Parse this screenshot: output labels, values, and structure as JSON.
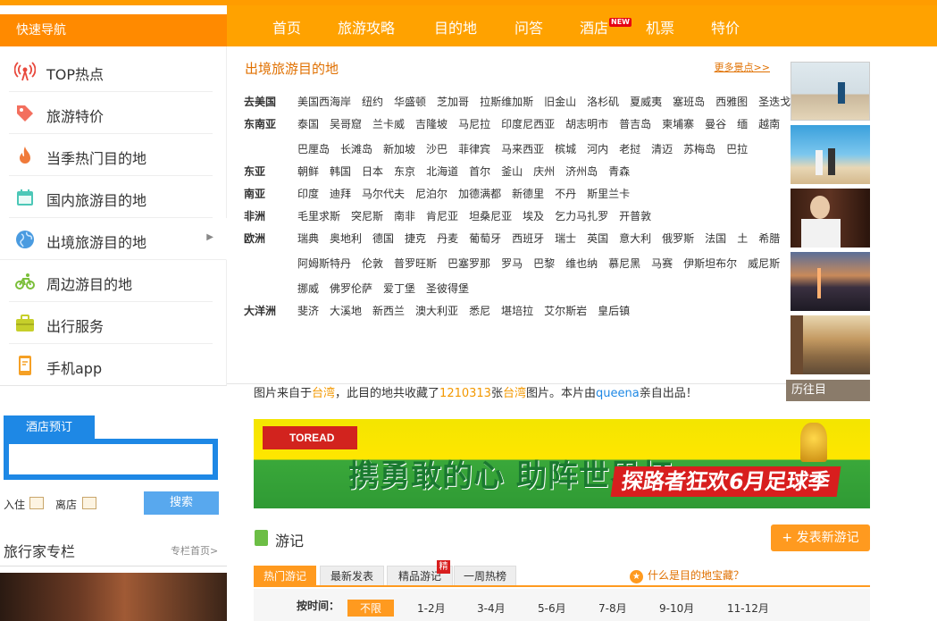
{
  "nav": {
    "quick_nav": "快速导航",
    "items": [
      "首页",
      "旅游攻略",
      "目的地",
      "问答",
      "酒店",
      "机票",
      "特价"
    ],
    "new_badge": "NEW"
  },
  "sidebar": {
    "items": [
      {
        "label": "TOP热点",
        "icon": "signal-icon"
      },
      {
        "label": "旅游特价",
        "icon": "tag-icon"
      },
      {
        "label": "当季热门目的地",
        "icon": "flame-icon"
      },
      {
        "label": "国内旅游目的地",
        "icon": "calendar-icon"
      },
      {
        "label": "出境旅游目的地",
        "icon": "globe-icon"
      },
      {
        "label": "周边游目的地",
        "icon": "bicycle-icon"
      },
      {
        "label": "出行服务",
        "icon": "briefcase-icon"
      },
      {
        "label": "手机app",
        "icon": "phone-icon"
      }
    ]
  },
  "panel": {
    "title": "出境旅游目的地",
    "more": "更多景点>>",
    "regions": [
      {
        "name": "去美国",
        "rows": [
          [
            "美国西海岸",
            "纽约",
            "华盛顿",
            "芝加哥",
            "拉斯维加斯",
            "旧金山",
            "洛杉矶",
            "夏威夷",
            "塞班岛",
            "西雅图",
            "圣迭戈"
          ]
        ]
      },
      {
        "name": "东南亚",
        "rows": [
          [
            "泰国",
            "吴哥窟",
            "兰卡威",
            "吉隆坡",
            "马尼拉",
            "印度尼西亚",
            "胡志明市",
            "普吉岛",
            "柬埔寨",
            "曼谷",
            "缅",
            "越南"
          ],
          [
            "巴厘岛",
            "长滩岛",
            "新加坡",
            "沙巴",
            "菲律宾",
            "马来西亚",
            "槟城",
            "河内",
            "老挝",
            "清迈",
            "苏梅岛",
            "巴拉"
          ]
        ]
      },
      {
        "name": "东亚",
        "rows": [
          [
            "朝鲜",
            "韩国",
            "日本",
            "东京",
            "北海道",
            "首尔",
            "釜山",
            "庆州",
            "济州岛",
            "青森"
          ]
        ]
      },
      {
        "name": "南亚",
        "rows": [
          [
            "印度",
            "迪拜",
            "马尔代夫",
            "尼泊尔",
            "加德满都",
            "新德里",
            "不丹",
            "斯里兰卡"
          ]
        ]
      },
      {
        "name": "非洲",
        "rows": [
          [
            "毛里求斯",
            "突尼斯",
            "南非",
            "肯尼亚",
            "坦桑尼亚",
            "埃及",
            "乞力马扎罗",
            "开普敦"
          ]
        ]
      },
      {
        "name": "欧洲",
        "rows": [
          [
            "瑞典",
            "奥地利",
            "德国",
            "捷克",
            "丹麦",
            "葡萄牙",
            "西班牙",
            "瑞士",
            "英国",
            "意大利",
            "俄罗斯",
            "法国",
            "土",
            "希腊"
          ],
          [
            "阿姆斯特丹",
            "伦敦",
            "普罗旺斯",
            "巴塞罗那",
            "罗马",
            "巴黎",
            "维也纳",
            "慕尼黑",
            "马赛",
            "伊斯坦布尔",
            "威尼斯"
          ],
          [
            "挪威",
            "佛罗伦萨",
            "爱丁堡",
            "圣彼得堡"
          ]
        ]
      },
      {
        "name": "大洋洲",
        "rows": [
          [
            "斐济",
            "大溪地",
            "新西兰",
            "澳大利亚",
            "悉尼",
            "堪培拉",
            "艾尔斯岩",
            "皇后镇"
          ]
        ]
      }
    ]
  },
  "caption": {
    "p1": "图片来自于",
    "place": "台湾",
    "p2": "，此目的地共收藏了",
    "count": "1210313",
    "p3": "张",
    "place2": "台湾",
    "p4": "图片。本片由",
    "user": "queena",
    "p5": "亲自出品！"
  },
  "history": "历往目",
  "hotel": {
    "tab": "酒店预订",
    "checkin": "入住",
    "checkout": "离店",
    "search": "搜索"
  },
  "columnist": {
    "title": "旅行家专栏",
    "link": "专栏首页>"
  },
  "banner": {
    "logo": "TOREAD",
    "line1": "携勇敢的心 助阵世界杯",
    "line2": "探路者狂欢6月足球季"
  },
  "travelogue": {
    "title": "游记",
    "new_button": "+ 发表新游记",
    "tabs": [
      "热门游记",
      "最新发表",
      "精品游记",
      "一周热榜"
    ],
    "jing": "精",
    "treasure": "什么是目的地宝藏？",
    "filter_label": "按时间：",
    "filters": [
      "不限",
      "1-2月",
      "3-4月",
      "5-6月",
      "7-8月",
      "9-10月",
      "11-12月"
    ]
  }
}
